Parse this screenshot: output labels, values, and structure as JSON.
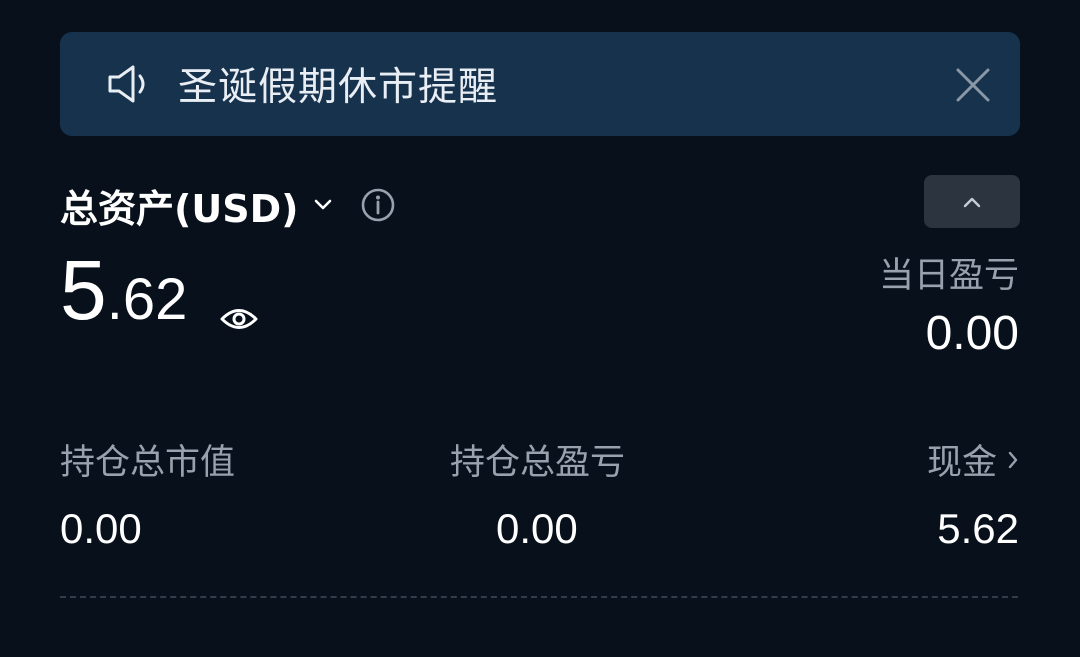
{
  "banner": {
    "text": "圣诞假期休市提醒",
    "speaker_icon": "speaker-icon",
    "close_icon": "close-icon"
  },
  "assets": {
    "title": "总资产(USD)",
    "total_integer": "5",
    "total_decimal": ".62",
    "day_pl_label": "当日盈亏",
    "day_pl_value": "0.00"
  },
  "stats": {
    "market_value_label": "持仓总市值",
    "market_value": "0.00",
    "position_pl_label": "持仓总盈亏",
    "position_pl": "0.00",
    "cash_label": "现金",
    "cash_value": "5.62"
  },
  "colors": {
    "background": "#08111b",
    "banner_bg": "#17324d",
    "muted_text": "#98a1ad",
    "button_bg": "#2c3440"
  }
}
